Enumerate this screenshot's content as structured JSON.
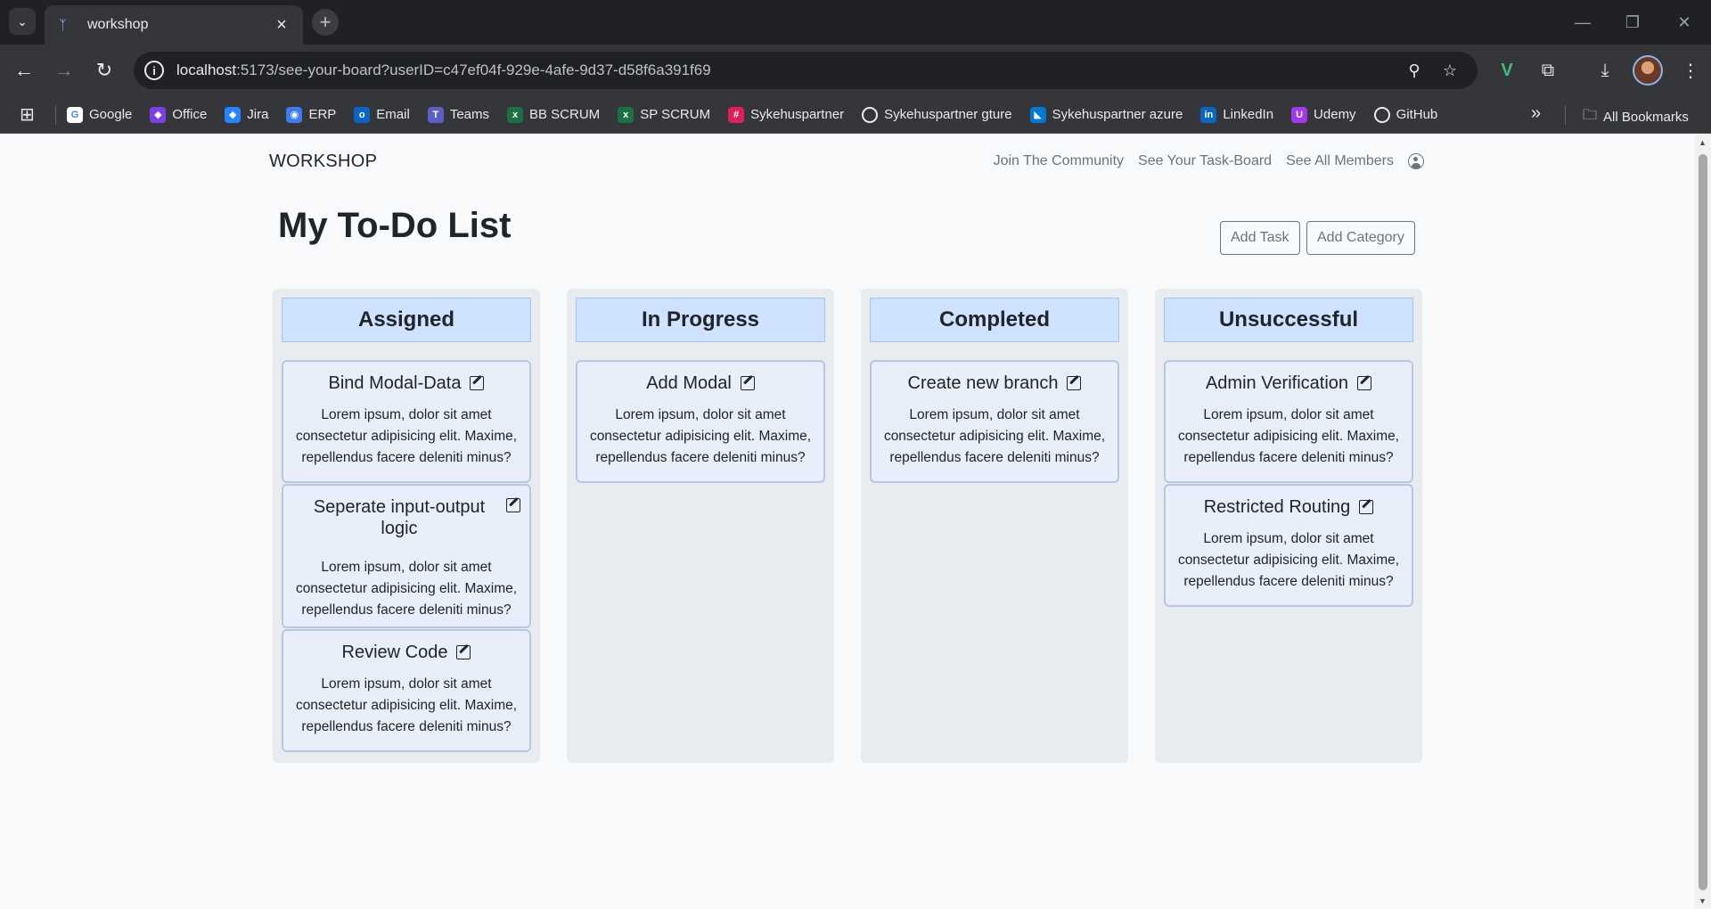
{
  "browser": {
    "tab_title": "workshop",
    "url_host": "localhost",
    "url_rest": ":5173/see-your-board?userID=c47ef04f-929e-4afe-9d37-d58f6a391f69",
    "bookmarks": [
      {
        "label": "Google",
        "icon": "google-icon"
      },
      {
        "label": "Office",
        "icon": "office-icon"
      },
      {
        "label": "Jira",
        "icon": "jira-icon"
      },
      {
        "label": "ERP",
        "icon": "erp-icon"
      },
      {
        "label": "Email",
        "icon": "outlook-icon"
      },
      {
        "label": "Teams",
        "icon": "teams-icon"
      },
      {
        "label": "BB SCRUM",
        "icon": "excel-icon"
      },
      {
        "label": "SP SCRUM",
        "icon": "excel-icon"
      },
      {
        "label": "Sykehuspartner",
        "icon": "slack-icon"
      },
      {
        "label": "Sykehuspartner gture",
        "icon": "github-icon"
      },
      {
        "label": "Sykehuspartner azure",
        "icon": "azure-devops-icon"
      },
      {
        "label": "LinkedIn",
        "icon": "linkedin-icon"
      },
      {
        "label": "Udemy",
        "icon": "udemy-icon"
      },
      {
        "label": "GitHub",
        "icon": "github-icon"
      }
    ],
    "all_bookmarks": "All Bookmarks"
  },
  "navbar": {
    "brand": "WORKSHOP",
    "links": [
      "Join The Community",
      "See Your Task-Board",
      "See All Members"
    ]
  },
  "page": {
    "title": "My To-Do List",
    "add_task": "Add Task",
    "add_category": "Add Category"
  },
  "board": {
    "columns": [
      {
        "title": "Assigned",
        "cards": [
          {
            "title": "Bind Modal-Data",
            "body": "Lorem ipsum, dolor sit amet consectetur adipisicing elit. Maxime, repellendus facere deleniti minus?"
          },
          {
            "title": "Seperate input-output logic",
            "body": "Lorem ipsum, dolor sit amet consectetur adipisicing elit. Maxime, repellendus facere deleniti minus?"
          },
          {
            "title": "Review Code",
            "body": "Lorem ipsum, dolor sit amet consectetur adipisicing elit. Maxime, repellendus facere deleniti minus?"
          }
        ]
      },
      {
        "title": "In Progress",
        "cards": [
          {
            "title": "Add Modal",
            "body": "Lorem ipsum, dolor sit amet consectetur adipisicing elit. Maxime, repellendus facere deleniti minus?"
          }
        ]
      },
      {
        "title": "Completed",
        "cards": [
          {
            "title": "Create new branch",
            "body": "Lorem ipsum, dolor sit amet consectetur adipisicing elit. Maxime, repellendus facere deleniti minus?"
          }
        ]
      },
      {
        "title": "Unsuccessful",
        "cards": [
          {
            "title": "Admin Verification",
            "body": "Lorem ipsum, dolor sit amet consectetur adipisicing elit. Maxime, repellendus facere deleniti minus?"
          },
          {
            "title": "Restricted Routing",
            "body": "Lorem ipsum, dolor sit amet consectetur adipisicing elit. Maxime, repellendus facere deleniti minus?"
          }
        ]
      }
    ]
  },
  "colors": {
    "column_bg": "#e9ecef",
    "column_header_bg": "#cfe2ff",
    "card_bg": "#e8eefa",
    "card_border": "#b6c7e6"
  }
}
